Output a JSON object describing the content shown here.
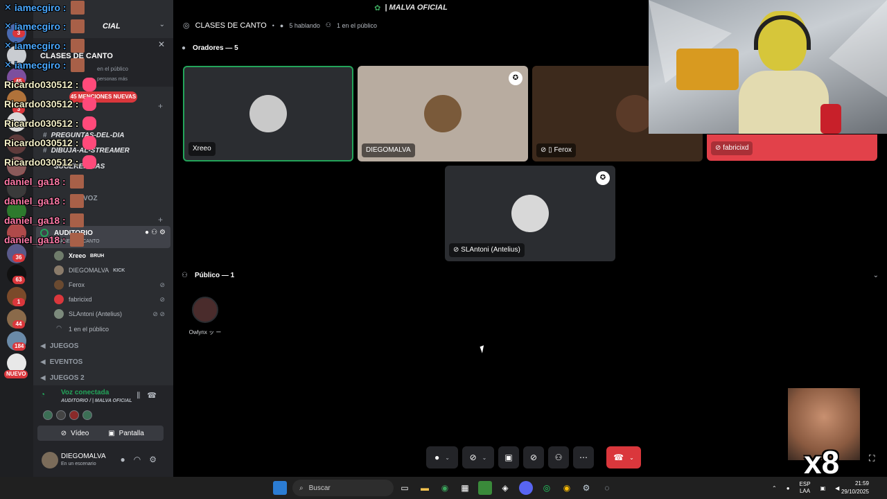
{
  "window": {
    "title": "| MALVA OFICIAL"
  },
  "rail": {
    "badges": [
      "3",
      "45",
      "3",
      "1",
      "382",
      "36",
      "63",
      "1",
      "44",
      "184"
    ],
    "new_label": "NUEVO"
  },
  "sidebar": {
    "server_name": "CIAL",
    "banner_title": "CLASES DE CANTO",
    "banner_line1": "en el público",
    "banner_line2": "personas más",
    "mentions": "45 MENCIONES NUEVAS",
    "channels": [
      {
        "label": "PREGUNTAS-DEL-DIA"
      },
      {
        "label": "DIBUJA-AL-STREAMER"
      },
      {
        "label": "SUGERENCIAS"
      }
    ],
    "categories": [
      "VOZ",
      "JUEGOS",
      "EVENTOS",
      "JUEGOS 2"
    ],
    "auditorio": {
      "name": "AUDITORIO",
      "subtitle": "CLASES DE CANTO"
    },
    "members": [
      {
        "name": "Xreeo",
        "tag": "BRUH",
        "bold": true,
        "color": "#6f7c6b"
      },
      {
        "name": "DIEGOMALVA",
        "tag": "KICK",
        "bold": false,
        "color": "#8a7b6a"
      },
      {
        "name": "Ferox",
        "tag": "",
        "bold": false,
        "color": "#6a4a30"
      },
      {
        "name": "fabricixd",
        "tag": "",
        "bold": false,
        "color": "#da373c"
      },
      {
        "name": "SLAntoni (Antelius)",
        "tag": "",
        "bold": false,
        "color": "#7c8a7c"
      }
    ],
    "audience_count": "1 en el público"
  },
  "voice": {
    "status": "Voz conectada",
    "location": "AUDITORIO / | MALVA OFICIAL",
    "video_label": "Vídeo",
    "screen_label": "Pantalla"
  },
  "user": {
    "name": "DIEGOMALVA",
    "status": "En un escenario"
  },
  "stage": {
    "title": "CLASES DE CANTO",
    "speaking": "5 hablando",
    "public": "1 en el público",
    "speakers_header": "Oradores — 5",
    "public_header": "Público — 1",
    "tiles": [
      {
        "name": "Xreeo",
        "bg": "#2b2d31",
        "avatar": "#c9c9c9"
      },
      {
        "name": "DIEGOMALVA",
        "bg": "#b8aca0",
        "avatar": "#7a5a3a"
      },
      {
        "name": "Ferox",
        "bg": "#3d2a1c",
        "avatar": "#5a3a28"
      },
      {
        "name": "SLAntoni (Antelius)",
        "bg": "#2b2d31",
        "avatar": "#d8d8d8"
      }
    ],
    "fabricixd_label": "fabricixd",
    "audience": [
      {
        "name": "Owlynx ッ ー"
      }
    ]
  },
  "overlay": {
    "chat": [
      {
        "user": "iamecgiro :",
        "color": "#4aa8ff"
      },
      {
        "user": "iamecgiro :",
        "color": "#4aa8ff"
      },
      {
        "user": "iamecgiro :",
        "color": "#4aa8ff"
      },
      {
        "user": "iamecgiro :",
        "color": "#4aa8ff"
      },
      {
        "user": "Ricardo030512 :",
        "color": "#f4f0c8"
      },
      {
        "user": "Ricardo030512 :",
        "color": "#f4f0c8"
      },
      {
        "user": "Ricardo030512 :",
        "color": "#f4f0c8"
      },
      {
        "user": "Ricardo030512 :",
        "color": "#f4f0c8"
      },
      {
        "user": "Ricardo030512 :",
        "color": "#f4f0c8"
      },
      {
        "user": "daniel_ga18 :",
        "color": "#ff7aa8"
      },
      {
        "user": "daniel_ga18 :",
        "color": "#ff7aa8"
      },
      {
        "user": "daniel_ga18 :",
        "color": "#ff7aa8"
      },
      {
        "user": "daniel_ga18 :",
        "color": "#ff7aa8"
      }
    ],
    "multiplier": "x8"
  },
  "taskbar": {
    "search_placeholder": "Buscar",
    "lang_line1": "ESP",
    "lang_line2": "LAA",
    "time": "21:59",
    "date": "29/10/2025"
  },
  "colors": {
    "accent_green": "#23a55a",
    "danger": "#da373c",
    "sidebar": "#2b2d31"
  }
}
